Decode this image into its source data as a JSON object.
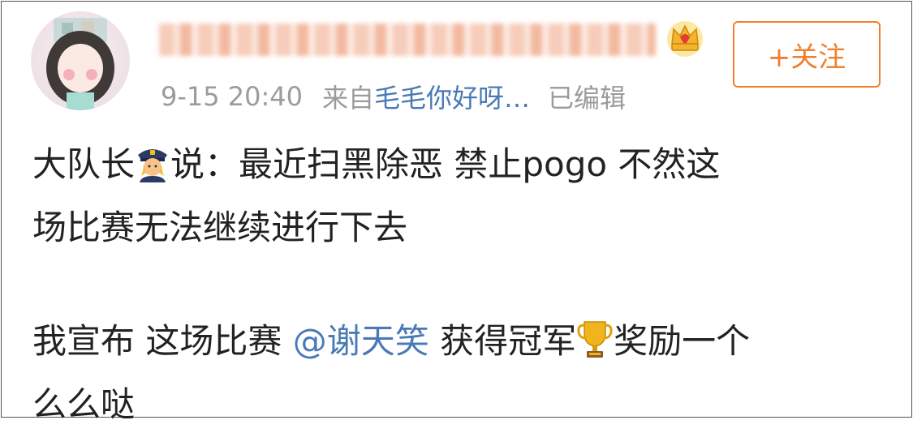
{
  "header": {
    "timestamp": "9-15 20:40",
    "source_prefix": "来自",
    "source_name": "毛毛你好呀…",
    "edited_label": "已编辑",
    "follow_label": "+关注"
  },
  "post": {
    "line1_a": "大队长",
    "line1_b": "说：最近扫黑除恶  禁止pogo  不然这",
    "line2": "场比赛无法继续进行下去",
    "line3_a": "我宣布 这场比赛 ",
    "mention": "@谢天笑",
    "line3_b": " 获得冠军",
    "line3_c": "奖励一个",
    "line4": "么么哒"
  },
  "icons": {
    "police": "police-officer-emoji",
    "trophy": "trophy-emoji",
    "crown": "crown-badge-icon"
  },
  "colors": {
    "accent": "#f08030",
    "link": "#4a7ab5",
    "meta": "#9b9b9b"
  }
}
